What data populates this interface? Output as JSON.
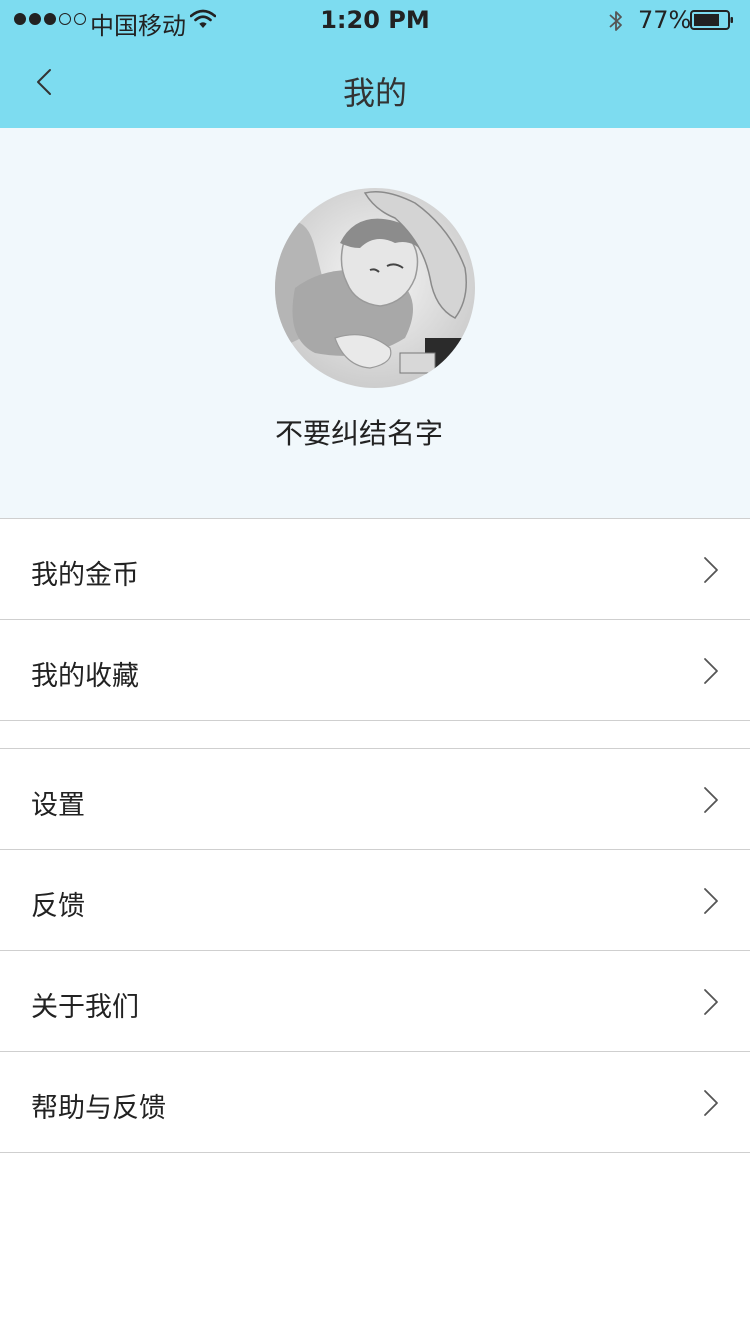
{
  "status_bar": {
    "carrier": "中国移动",
    "time": "1:20 PM",
    "battery": "77%",
    "signal_bars_filled": 3,
    "signal_bars_total": 5,
    "icons": [
      "wifi-icon",
      "bluetooth-icon",
      "battery-icon"
    ]
  },
  "nav": {
    "title": "我的",
    "back_icon": "chevron-left-icon"
  },
  "profile": {
    "username": "不要纠结名字",
    "avatar": "illustrated-portrait-avatar"
  },
  "menu_group_1": [
    {
      "label": "我的金币",
      "icon": "chevron-right-icon"
    },
    {
      "label": "我的收藏",
      "icon": "chevron-right-icon"
    }
  ],
  "menu_group_2": [
    {
      "label": "设置",
      "icon": "chevron-right-icon"
    },
    {
      "label": "反馈",
      "icon": "chevron-right-icon"
    },
    {
      "label": "关于我们",
      "icon": "chevron-right-icon"
    },
    {
      "label": "帮助与反馈",
      "icon": "chevron-right-icon"
    }
  ],
  "colors": {
    "header_bg": "#7ddcf0",
    "profile_bg": "#f1f8fc",
    "divider": "#cfcfcf"
  }
}
